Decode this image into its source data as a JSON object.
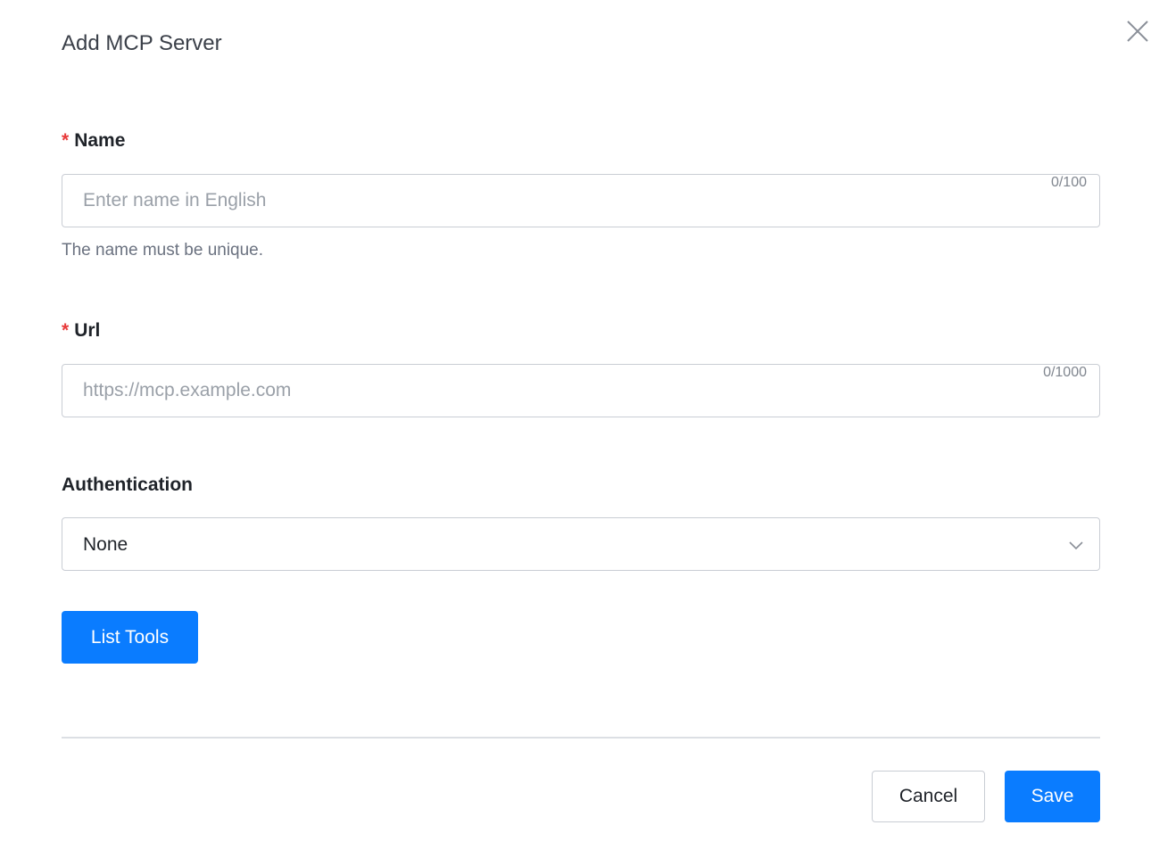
{
  "dialog": {
    "title": "Add MCP Server",
    "close_icon": "close-icon"
  },
  "form": {
    "name": {
      "required_mark": "*",
      "label": "Name",
      "placeholder": "Enter name in English",
      "value": "",
      "counter": "0/100",
      "help": "The name must be unique."
    },
    "url": {
      "required_mark": "*",
      "label": "Url",
      "placeholder": "https://mcp.example.com",
      "value": "",
      "counter": "0/1000"
    },
    "authentication": {
      "label": "Authentication",
      "selected": "None",
      "icon": "chevron-down-icon"
    },
    "list_tools_label": "List Tools"
  },
  "footer": {
    "cancel_label": "Cancel",
    "save_label": "Save"
  },
  "colors": {
    "primary": "#0a7cff",
    "required": "#e83a3a",
    "border": "#c9cdd4"
  }
}
